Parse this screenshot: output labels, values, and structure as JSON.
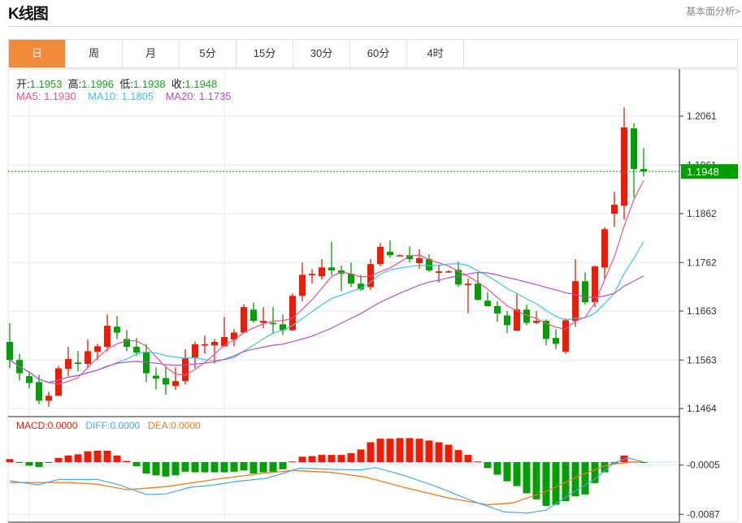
{
  "header": {
    "title": "K线图",
    "fundamental_link": "基本面分析>"
  },
  "tabs": [
    {
      "label": "日",
      "active": true
    },
    {
      "label": "周"
    },
    {
      "label": "月"
    },
    {
      "label": "5分"
    },
    {
      "label": "15分"
    },
    {
      "label": "30分"
    },
    {
      "label": "60分"
    },
    {
      "label": "4时"
    }
  ],
  "ohlc_info": {
    "open_label": "开:",
    "open": "1.1953",
    "high_label": "高:",
    "high": "1.1996",
    "low_label": "低:",
    "low": "1.1938",
    "close_label": "收:",
    "close": "1.1948"
  },
  "ma_info": {
    "ma5": "MA5: 1.1930",
    "ma10": "MA10: 1.1805",
    "ma20": "MA20: 1.1735"
  },
  "macd_info": {
    "macd": "MACD:0.0000",
    "diff": "DIFF:0.0000",
    "dea": "DEA:0.0000"
  },
  "colors": {
    "up": "#f21a00",
    "down": "#009f00",
    "ma5": "#f0508a",
    "ma10": "#3ec7dd",
    "ma20": "#b050c8",
    "diff": "#4aa8e8",
    "dea": "#f07a1a",
    "accent": "#f28a3c"
  },
  "chart_data": [
    {
      "type": "candlestick",
      "price_ticks": [
        "1.2061",
        "1.1961",
        "1.1862",
        "1.1762",
        "1.1663",
        "1.1563",
        "1.1464"
      ],
      "current_price": "1.1948",
      "candle_fields": [
        "open",
        "close",
        "high",
        "low"
      ],
      "candles": [
        [
          1.16,
          1.1563,
          1.1638,
          1.1546
        ],
        [
          1.1563,
          1.1536,
          1.1576,
          1.1521
        ],
        [
          1.153,
          1.1516,
          1.154,
          1.1505
        ],
        [
          1.1518,
          1.148,
          1.1533,
          1.1473
        ],
        [
          1.148,
          1.149,
          1.1498,
          1.1468
        ],
        [
          1.149,
          1.1546,
          1.1551,
          1.149
        ],
        [
          1.1545,
          1.1565,
          1.159,
          1.153
        ],
        [
          1.1558,
          1.1555,
          1.1581,
          1.154
        ],
        [
          1.1555,
          1.1581,
          1.1605,
          1.1546
        ],
        [
          1.158,
          1.1591,
          1.1596,
          1.1563
        ],
        [
          1.159,
          1.1633,
          1.1656,
          1.158
        ],
        [
          1.1631,
          1.1619,
          1.1653,
          1.1606
        ],
        [
          1.1606,
          1.159,
          1.1624,
          1.1581
        ],
        [
          1.159,
          1.1578,
          1.1608,
          1.1571
        ],
        [
          1.158,
          1.1536,
          1.1596,
          1.1518
        ],
        [
          1.1531,
          1.1525,
          1.1548,
          1.1503
        ],
        [
          1.1526,
          1.1513,
          1.1551,
          1.1492
        ],
        [
          1.151,
          1.152,
          1.1548,
          1.1502
        ],
        [
          1.152,
          1.1566,
          1.1585,
          1.1513
        ],
        [
          1.1568,
          1.1595,
          1.1601,
          1.1546
        ],
        [
          1.1593,
          1.1595,
          1.1613,
          1.1576
        ],
        [
          1.1593,
          1.16,
          1.1606,
          1.1556
        ],
        [
          1.1591,
          1.161,
          1.1651,
          1.159
        ],
        [
          1.1605,
          1.1619,
          1.1626,
          1.1591
        ],
        [
          1.1619,
          1.1671,
          1.1677,
          1.1618
        ],
        [
          1.1666,
          1.1643,
          1.1681,
          1.1639
        ],
        [
          1.1639,
          1.1643,
          1.1671,
          1.1628
        ],
        [
          1.1639,
          1.1636,
          1.1671,
          1.1616
        ],
        [
          1.1636,
          1.1624,
          1.1656,
          1.1614
        ],
        [
          1.1624,
          1.1694,
          1.1699,
          1.1623
        ],
        [
          1.1694,
          1.1737,
          1.1762,
          1.1683
        ],
        [
          1.1736,
          1.1739,
          1.1749,
          1.1719
        ],
        [
          1.1734,
          1.1752,
          1.1769,
          1.1727
        ],
        [
          1.1752,
          1.1746,
          1.1804,
          1.1736
        ],
        [
          1.1746,
          1.1739,
          1.1756,
          1.1704
        ],
        [
          1.1739,
          1.1719,
          1.1762,
          1.1712
        ],
        [
          1.1719,
          1.1707,
          1.1737,
          1.1704
        ],
        [
          1.1712,
          1.1759,
          1.1769,
          1.1706
        ],
        [
          1.1759,
          1.1794,
          1.1802,
          1.1754
        ],
        [
          1.1784,
          1.1777,
          1.1807,
          1.1772
        ],
        [
          1.1777,
          1.1777,
          1.1779,
          1.1776
        ],
        [
          1.1777,
          1.1769,
          1.1795,
          1.1762
        ],
        [
          1.1761,
          1.1771,
          1.1789,
          1.1749
        ],
        [
          1.1769,
          1.1746,
          1.1779,
          1.1742
        ],
        [
          1.1741,
          1.1744,
          1.1757,
          1.1721
        ],
        [
          1.1744,
          1.1744,
          1.1746,
          1.1742
        ],
        [
          1.1747,
          1.1717,
          1.1764,
          1.1712
        ],
        [
          1.1716,
          1.1719,
          1.1729,
          1.1658
        ],
        [
          1.1719,
          1.1686,
          1.1742,
          1.1684
        ],
        [
          1.1684,
          1.1673,
          1.1702,
          1.1673
        ],
        [
          1.1673,
          1.1658,
          1.1683,
          1.1641
        ],
        [
          1.1654,
          1.1634,
          1.1663,
          1.1618
        ],
        [
          1.1623,
          1.1666,
          1.1698,
          1.1623
        ],
        [
          1.1666,
          1.1639,
          1.1676,
          1.1634
        ],
        [
          1.1639,
          1.1643,
          1.1663,
          1.1636
        ],
        [
          1.1643,
          1.1606,
          1.1646,
          1.1593
        ],
        [
          1.1608,
          1.1596,
          1.1626,
          1.1585
        ],
        [
          1.158,
          1.1644,
          1.1648,
          1.1576
        ],
        [
          1.1643,
          1.1724,
          1.1769,
          1.1631
        ],
        [
          1.1724,
          1.1681,
          1.1742,
          1.1676
        ],
        [
          1.1681,
          1.1754,
          1.1756,
          1.1671
        ],
        [
          1.1752,
          1.183,
          1.1834,
          1.1729
        ],
        [
          1.1862,
          1.188,
          1.1907,
          1.1835
        ],
        [
          1.1878,
          1.2038,
          1.2079,
          1.185
        ],
        [
          1.2036,
          1.1953,
          1.2046,
          1.1895
        ],
        [
          1.1953,
          1.1948,
          1.1996,
          1.1938
        ]
      ]
    },
    {
      "type": "bar",
      "macd_ticks": [
        "-0.0005",
        "-0.0087"
      ],
      "histogram": [
        0.0005,
        -0.0001,
        -0.0006,
        -0.0008,
        -0.0001,
        0.0007,
        0.0011,
        0.0013,
        0.0018,
        0.0019,
        0.0019,
        0.0011,
        0.0002,
        -0.0007,
        -0.0019,
        -0.0022,
        -0.0024,
        -0.0022,
        -0.0016,
        -0.0017,
        -0.0017,
        -0.0017,
        -0.0017,
        -0.0016,
        -0.0014,
        -0.0019,
        -0.0017,
        -0.0016,
        -0.0012,
        0.0001,
        0.0009,
        0.001,
        0.0012,
        0.0012,
        0.0012,
        0.0015,
        0.0021,
        0.0033,
        0.0039,
        0.0039,
        0.004,
        0.004,
        0.0039,
        0.0036,
        0.0033,
        0.0029,
        0.002,
        0.0012,
        0.0001,
        -0.001,
        -0.0021,
        -0.0032,
        -0.004,
        -0.0052,
        -0.0062,
        -0.0073,
        -0.0071,
        -0.0065,
        -0.0057,
        -0.0054,
        -0.0035,
        -0.0017,
        -0.0002,
        0.0011,
        0.0001,
        0
      ],
      "diff": [
        [
          1,
          -0.0031
        ],
        [
          3.9,
          -0.0038
        ],
        [
          6,
          -0.0029
        ],
        [
          10,
          -0.0029
        ],
        [
          12,
          -0.0037
        ],
        [
          15,
          -0.0054
        ],
        [
          17,
          -0.0053
        ],
        [
          19.5,
          -0.0042
        ],
        [
          22,
          -0.0038
        ],
        [
          24.4,
          -0.0032
        ],
        [
          27.3,
          -0.0027
        ],
        [
          29,
          -0.0019
        ],
        [
          30.7,
          -0.001
        ],
        [
          34,
          -0.0012
        ],
        [
          37,
          -0.0013
        ],
        [
          38.5,
          -0.0009
        ],
        [
          41.4,
          -0.0022
        ],
        [
          44.8,
          -0.0041
        ],
        [
          48.8,
          -0.0067
        ],
        [
          51.7,
          -0.0083
        ],
        [
          54.1,
          -0.0085
        ],
        [
          56,
          -0.008
        ],
        [
          58.5,
          -0.0053
        ],
        [
          61,
          -0.0028
        ],
        [
          63,
          -0.0001
        ],
        [
          64.4,
          0.0007
        ],
        [
          66,
          0
        ]
      ],
      "dea": [
        [
          1,
          -0.0034
        ],
        [
          7,
          -0.0034
        ],
        [
          10,
          -0.0037
        ],
        [
          13,
          -0.0046
        ],
        [
          17,
          -0.0041
        ],
        [
          22,
          -0.0029
        ],
        [
          26.8,
          -0.0019
        ],
        [
          30,
          -0.0014
        ],
        [
          34,
          -0.0017
        ],
        [
          37.5,
          -0.0025
        ],
        [
          41.4,
          -0.0042
        ],
        [
          46,
          -0.006
        ],
        [
          50,
          -0.0071
        ],
        [
          52.6,
          -0.0068
        ],
        [
          56,
          -0.0049
        ],
        [
          59.5,
          -0.0022
        ],
        [
          62.4,
          -0.0004
        ],
        [
          64.8,
          0
        ],
        [
          66,
          0
        ]
      ]
    }
  ]
}
